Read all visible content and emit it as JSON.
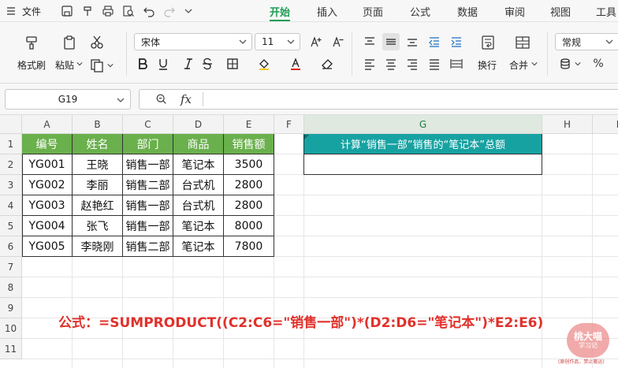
{
  "menu": {
    "file_label": "文件",
    "tabs": [
      {
        "label": "开始",
        "active": true
      },
      {
        "label": "插入"
      },
      {
        "label": "页面"
      },
      {
        "label": "公式"
      },
      {
        "label": "数据"
      },
      {
        "label": "审阅"
      },
      {
        "label": "视图"
      },
      {
        "label": "工具"
      }
    ]
  },
  "ribbon": {
    "format_painter": "格式刷",
    "paste": "粘贴",
    "font_name": "宋体",
    "font_size": "11",
    "wrap": "换行",
    "merge": "合并",
    "number_format": "常规",
    "percent": "%"
  },
  "formula_bar": {
    "cell_ref": "G19",
    "fx": "fx",
    "content": ""
  },
  "grid": {
    "columns": [
      "A",
      "B",
      "C",
      "D",
      "E",
      "F",
      "G",
      "H",
      "I"
    ],
    "selected_column": "G",
    "rows": [
      "1",
      "2",
      "3",
      "4",
      "5",
      "6",
      "7",
      "8",
      "9",
      "10",
      "11"
    ],
    "table": {
      "headers": [
        "编号",
        "姓名",
        "部门",
        "商品",
        "销售额"
      ],
      "records": [
        [
          "YG001",
          "王晓",
          "销售一部",
          "笔记本",
          "3500"
        ],
        [
          "YG002",
          "李丽",
          "销售二部",
          "台式机",
          "2800"
        ],
        [
          "YG003",
          "赵艳红",
          "销售一部",
          "台式机",
          "2800"
        ],
        [
          "YG004",
          "张飞",
          "销售一部",
          "笔记本",
          "8000"
        ],
        [
          "YG005",
          "李晓刚",
          "销售二部",
          "笔记本",
          "7800"
        ]
      ]
    },
    "question_title": "计算“销售一部”销售的“笔记本”总额",
    "question_answer": ""
  },
  "annotation": {
    "formula_text": "公式：=SUMPRODUCT((C2:C6=\"销售一部\")*(D2:D6=\"笔记本\")*E2:E6)"
  },
  "watermark": {
    "line1": "桃大喵",
    "line2": "学习记",
    "note": "(原创作品，禁止搬运)"
  },
  "colors": {
    "accent": "#1f9d55",
    "table_header": "#6ab04c",
    "title_cell": "#17a2a2",
    "formula_text": "#e0312b"
  }
}
